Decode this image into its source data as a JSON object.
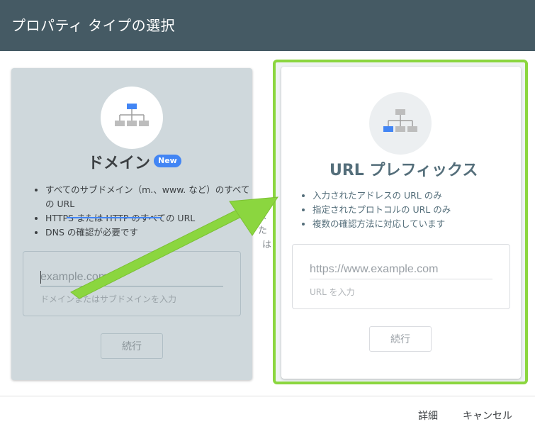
{
  "header": {
    "title": "プロパティ タイプの選択"
  },
  "domain_card": {
    "icon": "sitemap-icon",
    "title": "ドメイン",
    "badge": "New",
    "bullets": [
      "すべてのサブドメイン（m.、www. など）のすべての URL",
      "HTTPS または HTTP のすべての URL",
      "DNS の確認が必要です"
    ],
    "input_placeholder": "example.com",
    "input_helper": "ドメインまたはサブドメインを入力",
    "continue_label": "続行"
  },
  "partial_text": [
    "また",
    "は"
  ],
  "url_card": {
    "icon": "sitemap-icon",
    "title": "URL プレフィックス",
    "bullets": [
      "入力されたアドレスの URL のみ",
      "指定されたプロトコルの URL のみ",
      "複数の確認方法に対応しています"
    ],
    "input_placeholder": "https://www.example.com",
    "input_helper": "URL を入力",
    "continue_label": "続行"
  },
  "footer": {
    "details_label": "詳細",
    "cancel_label": "キャンセル"
  },
  "colors": {
    "header_bg": "#455a64",
    "domain_card_bg": "#cfd8dc",
    "accent_blue": "#4285f4",
    "highlight_green": "#8bd63f"
  }
}
